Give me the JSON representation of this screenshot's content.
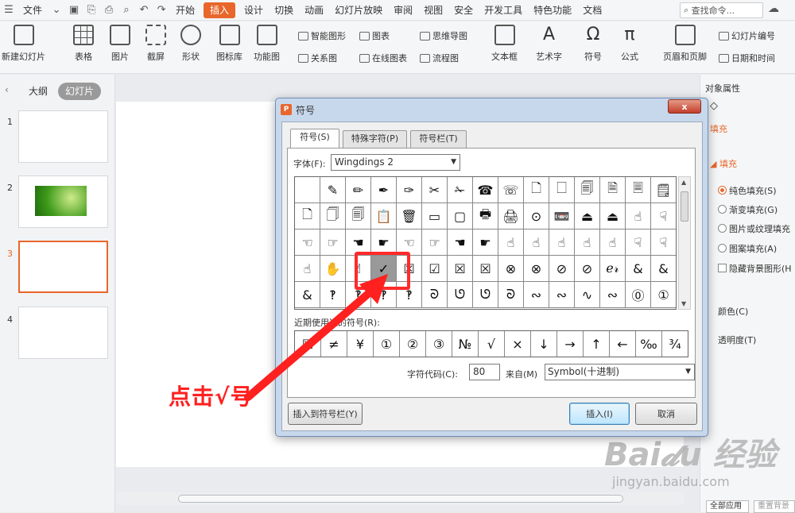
{
  "menubar": {
    "file": "文件",
    "items": [
      "开始",
      "插入",
      "设计",
      "切换",
      "动画",
      "幻灯片放映",
      "审阅",
      "视图",
      "安全",
      "开发工具",
      "特色功能",
      "文档"
    ],
    "search_placeholder": "查找命令..."
  },
  "ribbon": {
    "new_slide": "新建幻灯片",
    "table": "表格",
    "picture": "图片",
    "screenshot": "截屏",
    "shapes": "形状",
    "gallery": "图标库",
    "function_chart": "功能图",
    "smart_shape": "智能图形",
    "chart": "图表",
    "mindmap": "思维导图",
    "relation": "关系图",
    "online_chart": "在线图表",
    "flowchart": "流程图",
    "textbox": "文本框",
    "wordart": "艺术字",
    "symbol": "符号",
    "formula": "公式",
    "header_footer": "页眉和页脚",
    "slide_number": "幻灯片编号",
    "datetime": "日期和时间"
  },
  "left_panel": {
    "tab_outline": "大纲",
    "tab_slides": "幻灯片",
    "slides": [
      "1",
      "2",
      "3",
      "4"
    ]
  },
  "right_panel": {
    "title": "对象属性",
    "section": "填充",
    "fill_header": "填充",
    "options": [
      "纯色填充(S)",
      "渐变填充(G)",
      "图片或纹理填充",
      "图案填充(A)"
    ],
    "hide_bg": "隐藏背景图形(H",
    "color": "颜色(C)",
    "transparency": "透明度(T)",
    "apply_all": "全部应用",
    "reset_bg": "重置背景"
  },
  "dialog": {
    "title": "符号",
    "close": "x",
    "tabs": [
      "符号(S)",
      "特殊字符(P)",
      "符号栏(T)"
    ],
    "font_label": "字体(F):",
    "font_value": "Wingdings 2",
    "symbols": [
      "",
      "✎",
      "✏",
      "✒",
      "✑",
      "✂",
      "✁",
      "☎",
      "☏",
      "🗋",
      "🗌",
      "🗐",
      "🗎",
      "🗏",
      "🗒",
      "🗋",
      "🗍",
      "🗐",
      "📋",
      "🗑",
      "▭",
      "▢",
      "🖶",
      "🖨",
      "⊙",
      "📼",
      "⏏",
      "⏏",
      "☝",
      "☟",
      "☜",
      "☞",
      "☚",
      "☛",
      "☜",
      "☞",
      "☚",
      "☛",
      "☝",
      "☝",
      "☝",
      "☝",
      "☝",
      "☟",
      "☟",
      "☝",
      "✋",
      "✌",
      "✓",
      "☒",
      "☑",
      "☒",
      "☒",
      "⊗",
      "⊗",
      "⊘",
      "⊘",
      "ℯ𝓇",
      "&",
      "&",
      "&",
      "‽",
      "‽",
      "‽",
      "‽",
      "ᘐ",
      "ᘎ",
      "ᘎ",
      "ᘐ",
      "∾",
      "∾",
      "∿",
      "∾",
      "⓪",
      "①"
    ],
    "selected_index": 48,
    "recent_label": "近期使用过的符号(R):",
    "recent": [
      "☒",
      "≠",
      "¥",
      "①",
      "②",
      "③",
      "№",
      "√",
      "×",
      "↓",
      "→",
      "↑",
      "←",
      "‰",
      "¾"
    ],
    "code_label": "字符代码(C):",
    "code_value": "80",
    "from_label": "来自(M)",
    "from_value": "Symbol(十进制)",
    "btn_add_bar": "插入到符号栏(Y)",
    "btn_insert": "插入(I)",
    "btn_cancel": "取消"
  },
  "annotation": {
    "text": "点击√号",
    "color": "#ff2020"
  },
  "watermark": {
    "main": "Bai𝓭u 经验",
    "sub": "jingyan.baidu.com"
  },
  "colors": {
    "accent": "#e8662b",
    "annotation_red": "#ff2a2a"
  }
}
